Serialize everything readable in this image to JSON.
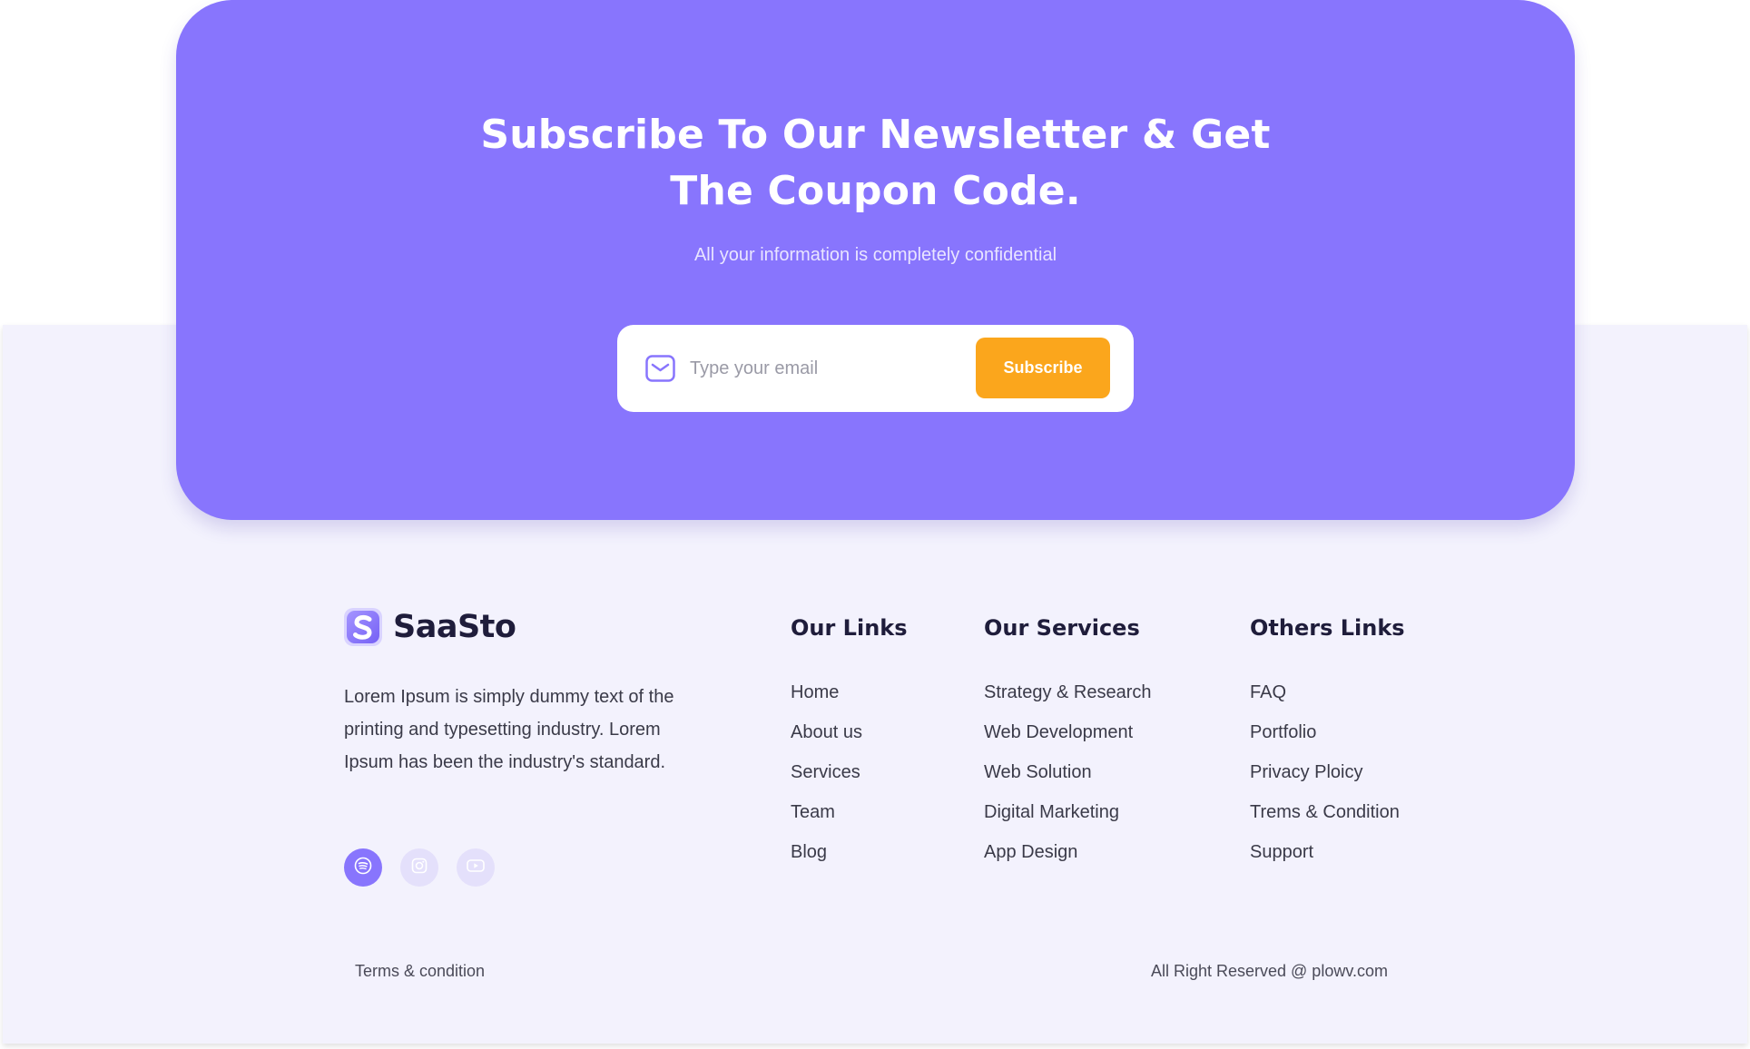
{
  "newsletter": {
    "title": "Subscribe To Our Newsletter & Get The Coupon Code.",
    "subtitle": "All your information is completely confidential",
    "email_placeholder": "Type your email",
    "subscribe_label": "Subscribe",
    "icon": "mail-icon"
  },
  "brand": {
    "name": "SaaSto",
    "description": "Lorem Ipsum is simply dummy text of the printing and typesetting industry. Lorem Ipsum has been the industry's standard."
  },
  "socials": [
    {
      "name": "spotify-icon",
      "active": true
    },
    {
      "name": "instagram-icon",
      "active": false
    },
    {
      "name": "youtube-icon",
      "active": false
    }
  ],
  "columns": {
    "our_links": {
      "title": "Our Links",
      "items": [
        "Home",
        "About us",
        "Services",
        "Team",
        "Blog"
      ]
    },
    "our_services": {
      "title": "Our Services",
      "items": [
        "Strategy & Research",
        "Web Development",
        "Web Solution",
        "Digital Marketing",
        "App Design"
      ]
    },
    "others_links": {
      "title": "Others Links",
      "items": [
        "FAQ",
        "Portfolio",
        "Privacy Ploicy",
        "Trems & Condition",
        "Support"
      ]
    }
  },
  "bottom": {
    "terms": "Terms & condition",
    "copyright": "All Right Reserved @ plowv.com"
  },
  "colors": {
    "accent": "#8875fd",
    "button": "#fba61c",
    "footer_bg": "#f3f2fd",
    "heading": "#1f1d3b"
  }
}
